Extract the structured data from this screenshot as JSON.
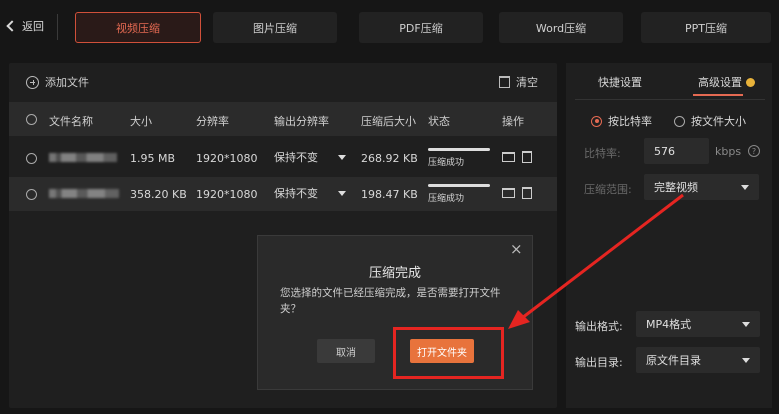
{
  "header": {
    "back_label": "返回",
    "tabs": [
      {
        "label": "视频压缩",
        "active": true
      },
      {
        "label": "图片压缩",
        "active": false
      },
      {
        "label": "PDF压缩",
        "active": false
      },
      {
        "label": "Word压缩",
        "active": false
      },
      {
        "label": "PPT压缩",
        "active": false
      }
    ]
  },
  "toolbar": {
    "add_file_label": "添加文件",
    "clear_label": "清空"
  },
  "table": {
    "headers": [
      "文件名称",
      "大小",
      "分辨率",
      "输出分辨率",
      "压缩后大小",
      "状态",
      "操作"
    ],
    "rows": [
      {
        "size": "1.95 MB",
        "resolution": "1920*1080",
        "output_resolution": "保持不变",
        "compressed_size": "268.92 KB",
        "status": "压缩成功"
      },
      {
        "size": "358.20 KB",
        "resolution": "1920*1080",
        "output_resolution": "保持不变",
        "compressed_size": "198.47 KB",
        "status": "压缩成功"
      }
    ]
  },
  "settings": {
    "tab_quick": "快捷设置",
    "tab_advanced": "高级设置",
    "mode_bitrate": "按比特率",
    "mode_filesize": "按文件大小",
    "bitrate_label": "比特率:",
    "bitrate_value": "576",
    "bitrate_unit": "kbps",
    "help_glyph": "?",
    "range_label": "压缩范围:",
    "range_value": "完整视频",
    "format_label": "输出格式:",
    "format_value": "MP4格式",
    "dir_label": "输出目录:",
    "dir_value": "原文件目录"
  },
  "dialog": {
    "title": "压缩完成",
    "message": "您选择的文件已经压缩完成，是否需要打开文件夹？",
    "close_glyph": "×",
    "cancel_label": "取消",
    "open_label": "打开文件夹"
  },
  "colors": {
    "accent": "#e56a52",
    "button": "#e8733c",
    "highlight": "#e52521",
    "badge": "#e8b23a"
  }
}
